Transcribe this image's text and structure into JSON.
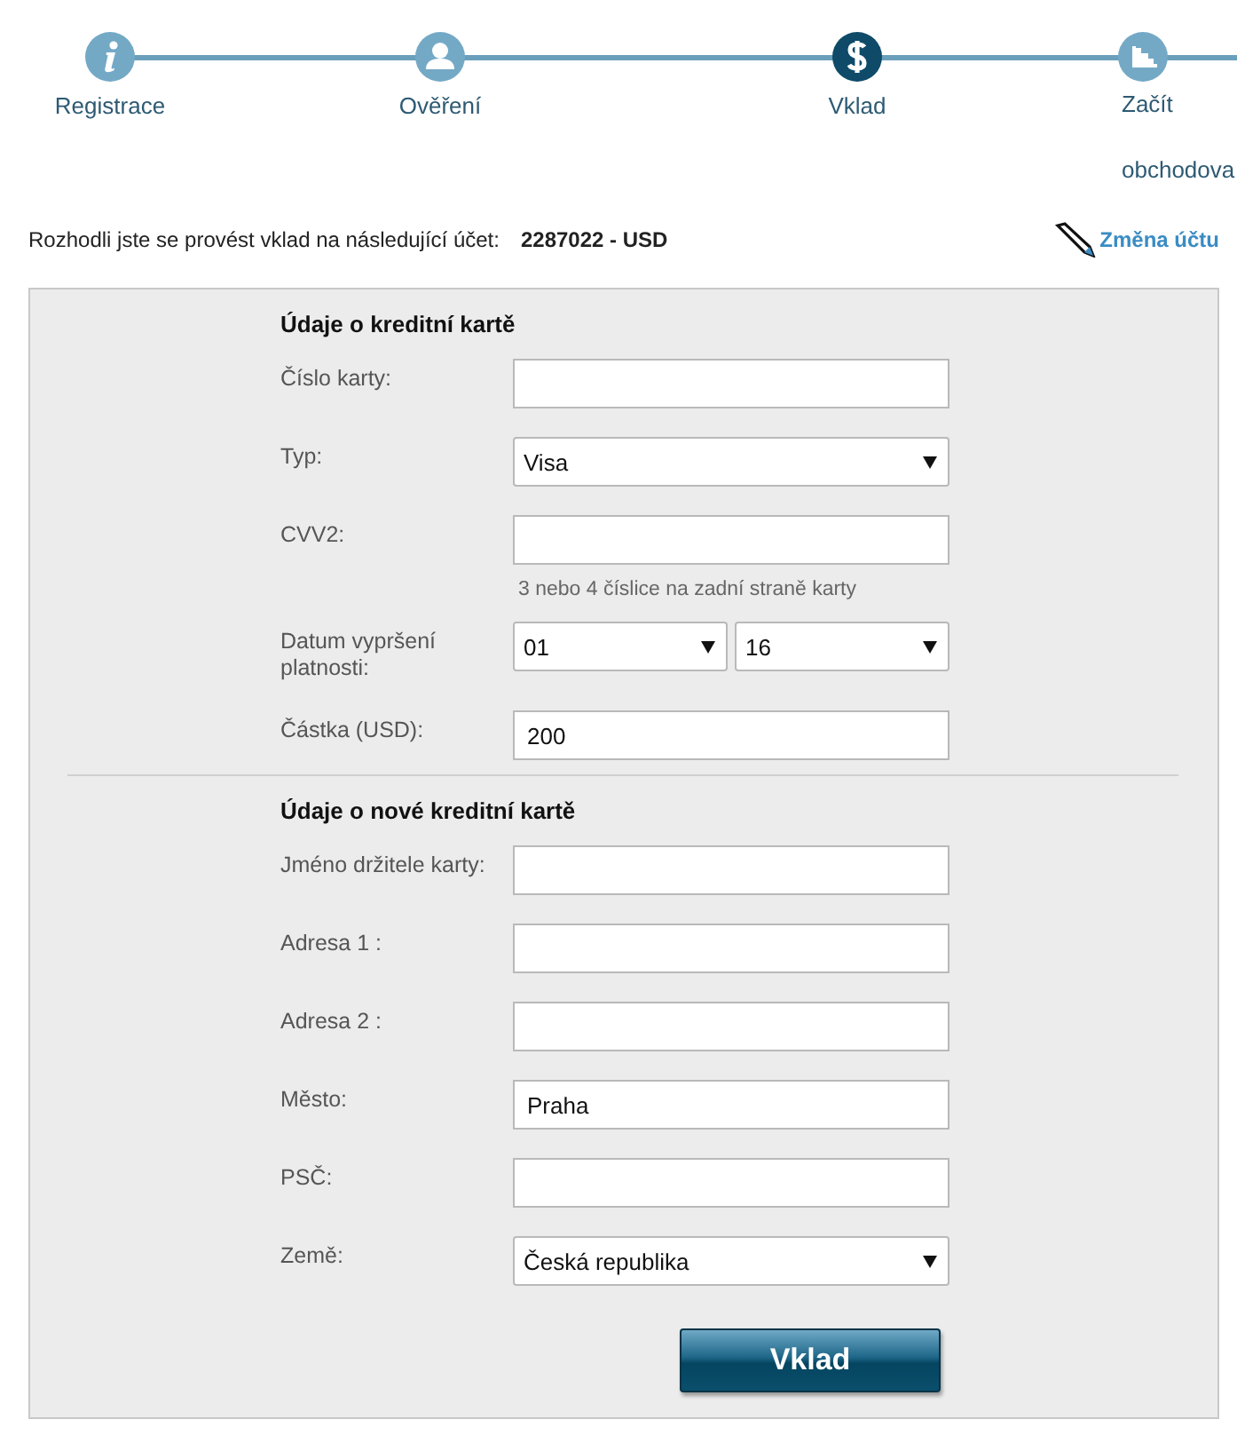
{
  "steps": [
    {
      "label": "Registrace",
      "selected": false
    },
    {
      "label": "Ověření",
      "selected": false
    },
    {
      "label": "Vklad",
      "selected": true
    },
    {
      "label": "Začít obchodova",
      "selected": false
    }
  ],
  "account": {
    "text": "Rozhodli jste se provést vklad na následující účet:",
    "number": "2287022 - USD",
    "change_link": "Změna účtu"
  },
  "sections": [
    {
      "title": "Údaje o kreditní kartě",
      "fields": [
        {
          "kind": "input",
          "label": "Číslo karty:"
        },
        {
          "kind": "select",
          "label": "Typ:",
          "value": "Visa"
        },
        {
          "kind": "input",
          "label": "CVV2:"
        },
        {
          "kind": "hint",
          "text": "3 nebo 4 číslice na zadní straně karty"
        },
        {
          "kind": "select-pair",
          "label": "Datum vypršení platnosti:",
          "values": [
            "01",
            "16"
          ]
        },
        {
          "kind": "input",
          "label": "Částka (USD):",
          "value": "200"
        }
      ]
    },
    {
      "title": "Údaje o nové kreditní kartě",
      "fields": [
        {
          "kind": "input",
          "label": "Jméno držitele karty:"
        },
        {
          "kind": "input",
          "label": "Adresa 1 :"
        },
        {
          "kind": "input",
          "label": "Adresa 2 :"
        },
        {
          "kind": "input",
          "label": "Město:",
          "value": "Praha"
        },
        {
          "kind": "input",
          "label": "PSČ:"
        },
        {
          "kind": "select",
          "label": "Země:",
          "value": "Česká republika"
        }
      ]
    }
  ],
  "submit": "Vklad"
}
